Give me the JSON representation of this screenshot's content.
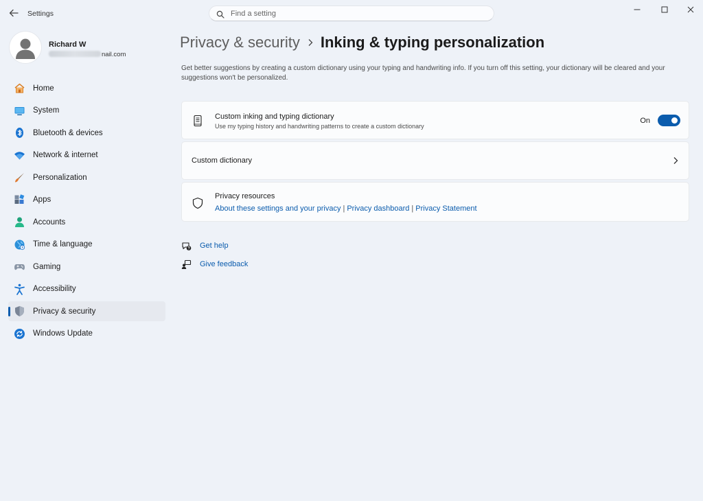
{
  "window": {
    "title": "Settings"
  },
  "search": {
    "placeholder": "Find a setting",
    "icon": "search-icon"
  },
  "profile": {
    "name": "Richard W",
    "email_visible": "nail.com"
  },
  "sidebar": {
    "items": [
      {
        "label": "Home",
        "icon": "home-icon"
      },
      {
        "label": "System",
        "icon": "system-icon"
      },
      {
        "label": "Bluetooth & devices",
        "icon": "bluetooth-icon"
      },
      {
        "label": "Network & internet",
        "icon": "wifi-icon"
      },
      {
        "label": "Personalization",
        "icon": "brush-icon"
      },
      {
        "label": "Apps",
        "icon": "apps-icon"
      },
      {
        "label": "Accounts",
        "icon": "accounts-icon"
      },
      {
        "label": "Time & language",
        "icon": "globe-icon"
      },
      {
        "label": "Gaming",
        "icon": "gamepad-icon"
      },
      {
        "label": "Accessibility",
        "icon": "accessibility-icon"
      },
      {
        "label": "Privacy & security",
        "icon": "shield-icon",
        "active": true
      },
      {
        "label": "Windows Update",
        "icon": "update-icon"
      }
    ]
  },
  "breadcrumb": {
    "parent": "Privacy & security",
    "current": "Inking & typing personalization"
  },
  "description": "Get better suggestions by creating a custom dictionary using your typing and handwriting info. If you turn off this setting, your dictionary will be cleared and your suggestions won't be personalized.",
  "cards": {
    "dictionary_toggle": {
      "title": "Custom inking and typing dictionary",
      "subtitle": "Use my typing history and handwriting patterns to create a custom dictionary",
      "state_label": "On",
      "enabled": true,
      "icon": "dictionary-icon"
    },
    "custom_dictionary": {
      "title": "Custom dictionary"
    },
    "privacy_resources": {
      "title": "Privacy resources",
      "icon": "shield-outline-icon",
      "links": [
        "About these settings and your privacy",
        "Privacy dashboard",
        "Privacy Statement"
      ],
      "separator": "|"
    }
  },
  "help": {
    "get_help": "Get help",
    "give_feedback": "Give feedback"
  },
  "colors": {
    "accent": "#0b5cad",
    "background": "#eef2f8",
    "card": "#fbfcfd"
  }
}
